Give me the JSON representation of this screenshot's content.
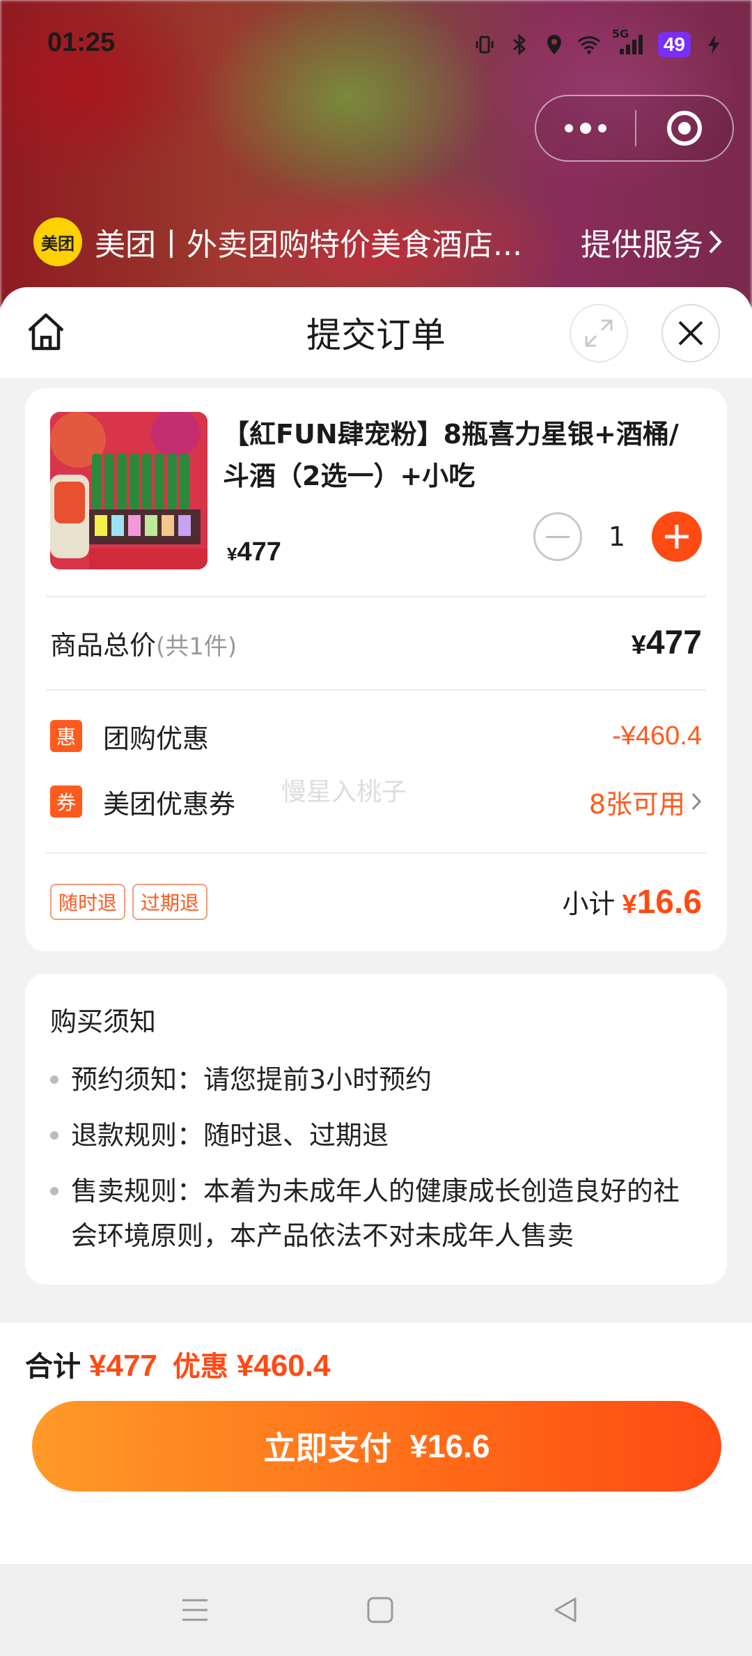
{
  "status_bar": {
    "time": "01:25",
    "network": "5G",
    "battery": "49"
  },
  "mini_program": {
    "logo_text": "美团",
    "merchant_name": "美团丨外卖团购特价美食酒店...",
    "service_label": "提供服务"
  },
  "panel": {
    "title": "提交订单"
  },
  "product": {
    "title": "【紅FUN肆宠粉】8瓶喜力星银+酒桶/斗酒（2选一）+小吃",
    "price_symbol": "¥",
    "price": "477",
    "quantity": "1"
  },
  "summary": {
    "total_label": "商品总价",
    "total_count": "(共1件)",
    "total_symbol": "¥",
    "total_value": "477",
    "group_discount_icon": "惠",
    "group_discount_label": "团购优惠",
    "group_discount_value": "-¥460.4",
    "coupon_icon": "券",
    "coupon_label": "美团优惠券",
    "coupon_value": "8张可用",
    "watermark": "慢星入桃子",
    "tags": [
      "随时退",
      "过期退"
    ],
    "subtotal_label": "小计",
    "subtotal_symbol": "¥",
    "subtotal_value": "16.6"
  },
  "notice": {
    "title": "购买须知",
    "items": [
      "预约须知：请您提前3小时预约",
      "退款规则：随时退、过期退",
      "售卖规则：本着为未成年人的健康成长创造良好的社会环境原则，本产品依法不对未成年人售卖"
    ]
  },
  "bottom": {
    "sum_label": "合计",
    "sum_total": "¥477",
    "discount_label": "优惠",
    "discount_total": "¥460.4",
    "pay_label": "立即支付",
    "pay_amount": "¥16.6"
  },
  "colors": {
    "accent": "#ff4a14",
    "brand_yellow": "#ffd100",
    "battery": "#7a2ff5"
  }
}
